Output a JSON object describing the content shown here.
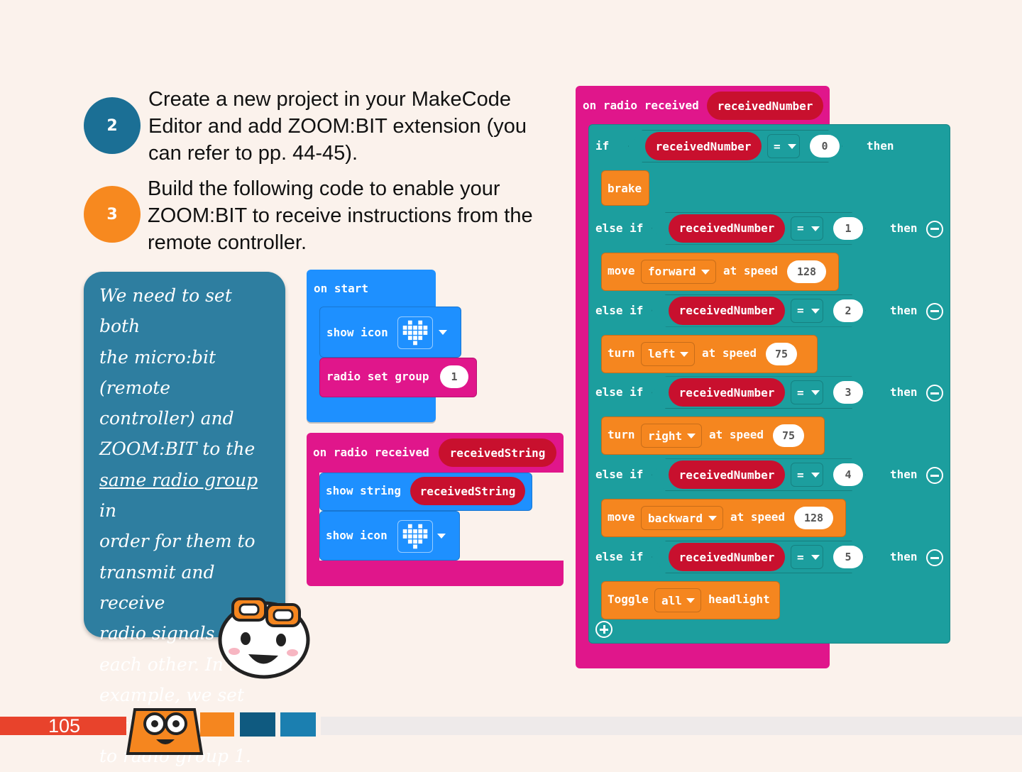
{
  "steps": [
    {
      "number": "2",
      "color": "#1b6f95",
      "lines": [
        "Create a new project in your MakeCode",
        "Editor and add ZOOM:BIT extension (you",
        "can refer to pp. 44-45)."
      ]
    },
    {
      "number": "3",
      "color": "#f7891f",
      "lines": [
        "Build the following code to enable your",
        "ZOOM:BIT to receive instructions from the",
        "remote controller."
      ]
    }
  ],
  "note": {
    "lines": [
      "We need to set both",
      "the micro:bit (remote",
      "controller) and",
      "ZOOM:BIT to the"
    ],
    "underlined": "same radio group",
    "after_underline": " in",
    "rest": [
      "order for them to",
      "transmit and receive",
      "radio signals from",
      "each other. In this",
      "example, we set both",
      "to radio group 1."
    ]
  },
  "on_start": {
    "label": "on start",
    "show_icon": "show icon",
    "radio_set_group": "radio set group",
    "group_value": "1"
  },
  "on_radio_string": {
    "label": "on radio received",
    "param": "receivedString",
    "show_string": "show string",
    "show_string_value": "receivedString",
    "show_icon": "show icon"
  },
  "on_radio_number": {
    "label": "on radio received",
    "param": "receivedNumber",
    "if_label": "if",
    "else_if_label": "else if",
    "then_label": "then",
    "op": "=",
    "variable": "receivedNumber",
    "branches": [
      {
        "value": "0",
        "action": {
          "kind": "brake",
          "word": "brake"
        }
      },
      {
        "value": "1",
        "action": {
          "kind": "move",
          "word": "move",
          "dir": "forward",
          "speed_label": "at speed",
          "speed": "128"
        }
      },
      {
        "value": "2",
        "action": {
          "kind": "turn",
          "word": "turn",
          "dir": "left",
          "speed_label": "at speed",
          "speed": "75"
        }
      },
      {
        "value": "3",
        "action": {
          "kind": "turn",
          "word": "turn",
          "dir": "right",
          "speed_label": "at speed",
          "speed": "75"
        }
      },
      {
        "value": "4",
        "action": {
          "kind": "move",
          "word": "move",
          "dir": "backward",
          "speed_label": "at speed",
          "speed": "128"
        }
      },
      {
        "value": "5",
        "action": {
          "kind": "toggle",
          "word": "Toggle",
          "dir": "all",
          "speed_label": "headlight"
        }
      }
    ]
  },
  "footer": {
    "page_number": "105"
  },
  "colors": {
    "event": "#e0168b",
    "logic": "#1c9e9e",
    "basic": "#1e90ff",
    "motor": "#f5861f",
    "variable": "#c8102e",
    "page_orange": "#e8432c"
  }
}
